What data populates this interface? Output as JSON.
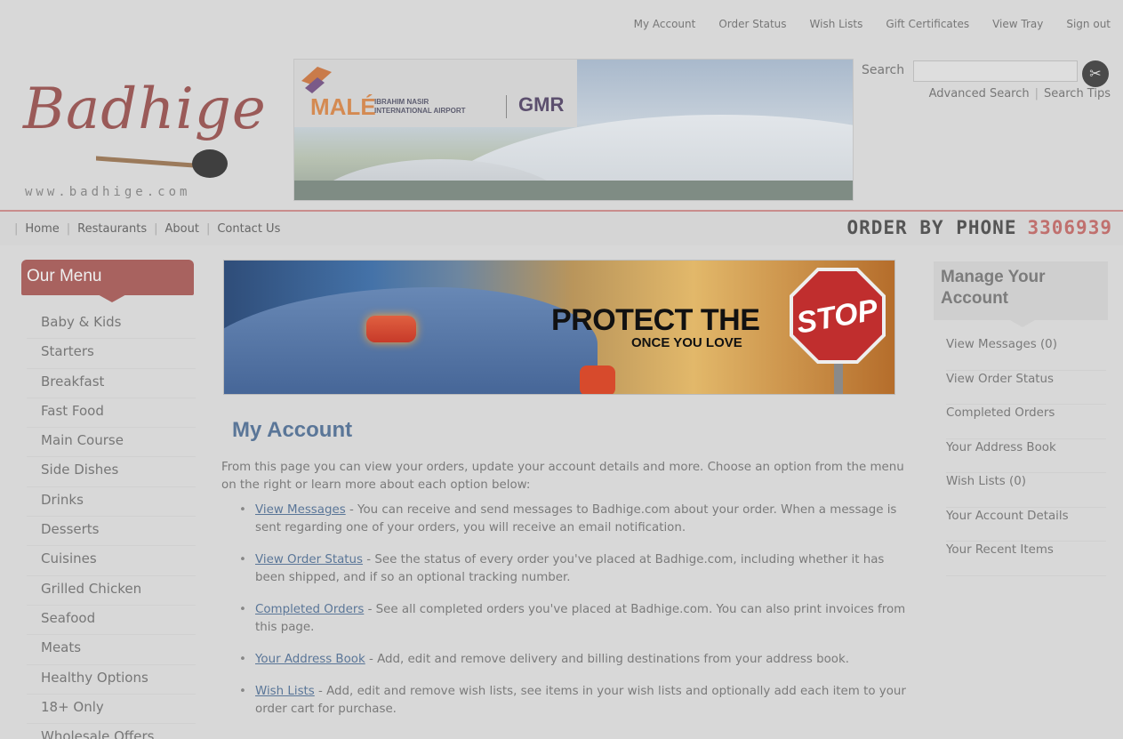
{
  "top_links": [
    "My Account",
    "Order Status",
    "Wish Lists",
    "Gift Certificates",
    "View Tray",
    "Sign out"
  ],
  "logo": {
    "script": "Badhige",
    "url": "www.badhige.com"
  },
  "ad_banner": {
    "male": "MALÉ",
    "airport_line1": "IBRAHIM NASIR",
    "airport_line2": "INTERNATIONAL AIRPORT",
    "gmr": "GMR"
  },
  "search": {
    "label": "Search",
    "value": "",
    "advanced": "Advanced Search",
    "tips": "Search Tips",
    "button_icon": "fork-knife-icon"
  },
  "nav": {
    "items": [
      "Home",
      "Restaurants",
      "About",
      "Contact Us"
    ]
  },
  "order_by_phone": {
    "label": "ORDER BY PHONE",
    "number": "3306939"
  },
  "menu": {
    "title": "Our Menu",
    "items": [
      "Baby & Kids",
      "Starters",
      "Breakfast",
      "Fast Food",
      "Main Course",
      "Side Dishes",
      "Drinks",
      "Desserts",
      "Cuisines",
      "Grilled Chicken",
      "Seafood",
      "Meats",
      "Healthy Options",
      "18+ Only",
      "Wholesale Offers"
    ]
  },
  "promo": {
    "headline": "PROTECT THE",
    "sub": "ONCE YOU LOVE",
    "sign": "STOP"
  },
  "main": {
    "title": "My Account",
    "intro": "From this page you can view your orders, update your account details and more. Choose an option from the menu on the right or learn more about each option below:",
    "options": [
      {
        "link": "View Messages",
        "text": " - You can receive and send messages to Badhige.com about your order. When a message is sent regarding one of your orders, you will receive an email notification."
      },
      {
        "link": "View Order Status",
        "text": " - See the status of every order you've placed at Badhige.com, including whether it has been shipped, and if so an optional tracking number."
      },
      {
        "link": "Completed Orders",
        "text": " - See all completed orders you've placed at Badhige.com. You can also print invoices from this page."
      },
      {
        "link": "Your Address Book",
        "text": " - Add, edit and remove delivery and billing destinations from your address book."
      },
      {
        "link": "Wish Lists",
        "text": " - Add, edit and remove wish lists, see items in your wish lists and optionally add each item to your order cart for purchase."
      }
    ]
  },
  "account_panel": {
    "title": "Manage Your Account",
    "items": [
      "View Messages (0)",
      "View Order Status",
      "Completed Orders",
      "Your Address Book",
      "Wish Lists (0)",
      "Your Account Details",
      "Your Recent Items"
    ]
  },
  "colors": {
    "brand": "#a8625f",
    "link": "#5a7698",
    "phone_number": "#c0706e"
  }
}
